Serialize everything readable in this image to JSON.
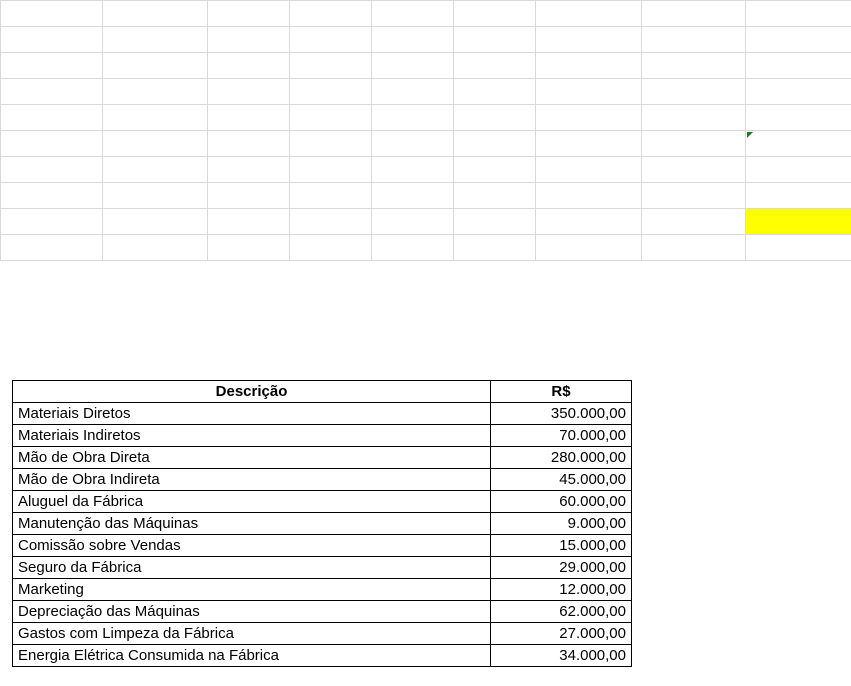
{
  "table": {
    "headers": {
      "description": "Descrição",
      "value": "R$"
    },
    "rows": [
      {
        "description": "Materiais Diretos",
        "value": "350.000,00"
      },
      {
        "description": "Materiais Indiretos",
        "value": "70.000,00"
      },
      {
        "description": "Mão de Obra Direta",
        "value": "280.000,00"
      },
      {
        "description": "Mão de Obra Indireta",
        "value": "45.000,00"
      },
      {
        "description": "Aluguel da Fábrica",
        "value": "60.000,00"
      },
      {
        "description": "Manutenção das Máquinas",
        "value": "9.000,00"
      },
      {
        "description": "Comissão sobre Vendas",
        "value": "15.000,00"
      },
      {
        "description": "Seguro da Fábrica",
        "value": "29.000,00"
      },
      {
        "description": "Marketing",
        "value": "12.000,00"
      },
      {
        "description": "Depreciação das Máquinas",
        "value": "62.000,00"
      },
      {
        "description": "Gastos com Limpeza da Fábrica",
        "value": "27.000,00"
      },
      {
        "description": "Energia Elétrica Consumida na Fábrica",
        "value": "34.000,00"
      }
    ]
  },
  "colors": {
    "highlight_cell": "#ffff00",
    "grid_line": "#d9d9d9",
    "comment_marker": "#1e7b1e"
  }
}
